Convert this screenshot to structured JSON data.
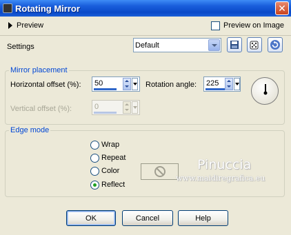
{
  "window": {
    "title": "Rotating Mirror",
    "close_glyph": "✕"
  },
  "preview_row": {
    "preview_label": "Preview",
    "preview_on_image_label": "Preview on Image",
    "preview_on_image_checked": false
  },
  "settings_row": {
    "label": "Settings",
    "preset_value": "Default",
    "icons": [
      "save-icon",
      "dice-icon",
      "reset-icon"
    ]
  },
  "mirror_placement": {
    "group_label": "Mirror placement",
    "horizontal_offset_label": "Horizontal offset (%):",
    "horizontal_offset_value": "50",
    "rotation_angle_label": "Rotation angle:",
    "rotation_angle_value": "225",
    "vertical_offset_label": "Vertical offset (%):",
    "vertical_offset_value": "0",
    "vertical_offset_enabled": false
  },
  "edge_mode": {
    "group_label": "Edge mode",
    "options": [
      "Wrap",
      "Repeat",
      "Color",
      "Reflect"
    ],
    "selected": "Reflect"
  },
  "watermark": {
    "name": "Pinuccia",
    "url": "www.maidiregrafica.eu"
  },
  "buttons": {
    "ok": "OK",
    "cancel": "Cancel",
    "help": "Help"
  },
  "colors": {
    "title_bar": "#0a49c8",
    "group_label": "#0046d5",
    "selected_radio": "#21a121",
    "dialog_bg": "#ece9d8"
  }
}
